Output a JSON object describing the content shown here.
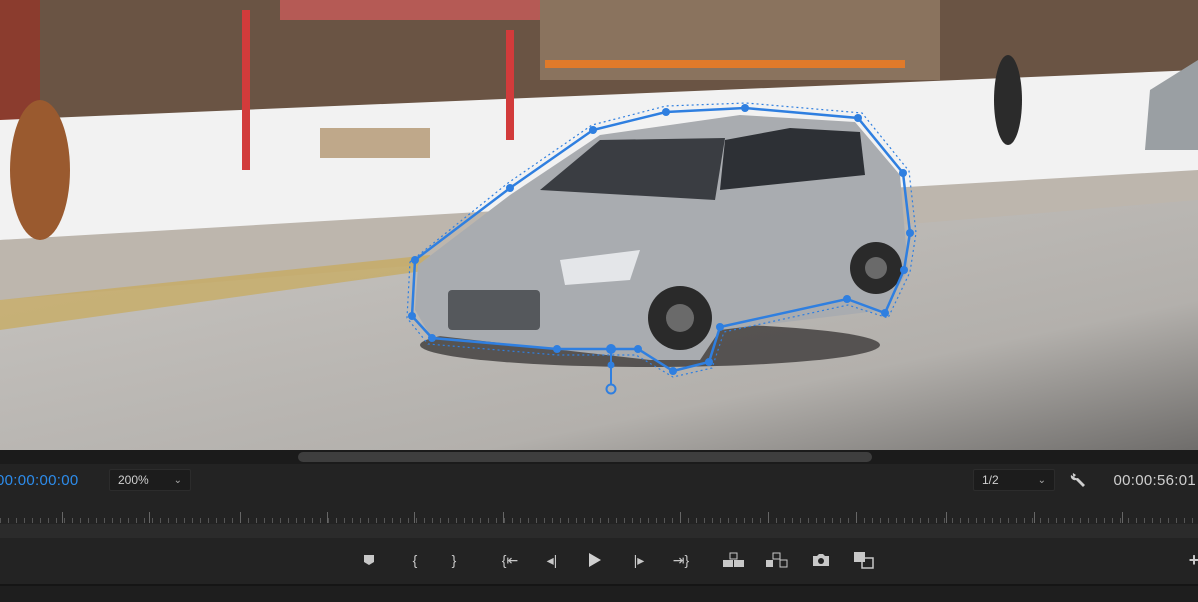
{
  "monitor": {
    "current_timecode": "00:00:00:00",
    "zoom_level": "200%",
    "resolution": "1/2",
    "duration_timecode": "00:00:56:01"
  },
  "transport": {
    "buttons": [
      {
        "name": "add-marker",
        "glyph": "⬟"
      },
      {
        "name": "mark-in",
        "glyph": "{"
      },
      {
        "name": "mark-out",
        "glyph": "}"
      },
      {
        "name": "go-to-in",
        "glyph": "{⇤"
      },
      {
        "name": "step-back",
        "glyph": "◂|"
      },
      {
        "name": "play",
        "glyph": "▶"
      },
      {
        "name": "step-forward",
        "glyph": "|▸"
      },
      {
        "name": "go-to-out",
        "glyph": "⇥}"
      },
      {
        "name": "lift",
        "glyph": "⊞"
      },
      {
        "name": "extract",
        "glyph": "⊟"
      },
      {
        "name": "export-frame",
        "glyph": "📷"
      },
      {
        "name": "comparison-view",
        "glyph": "⧉"
      }
    ],
    "add_button": "+"
  },
  "colors": {
    "accent": "#2d8ceb",
    "mask": "#2f7fe0"
  }
}
